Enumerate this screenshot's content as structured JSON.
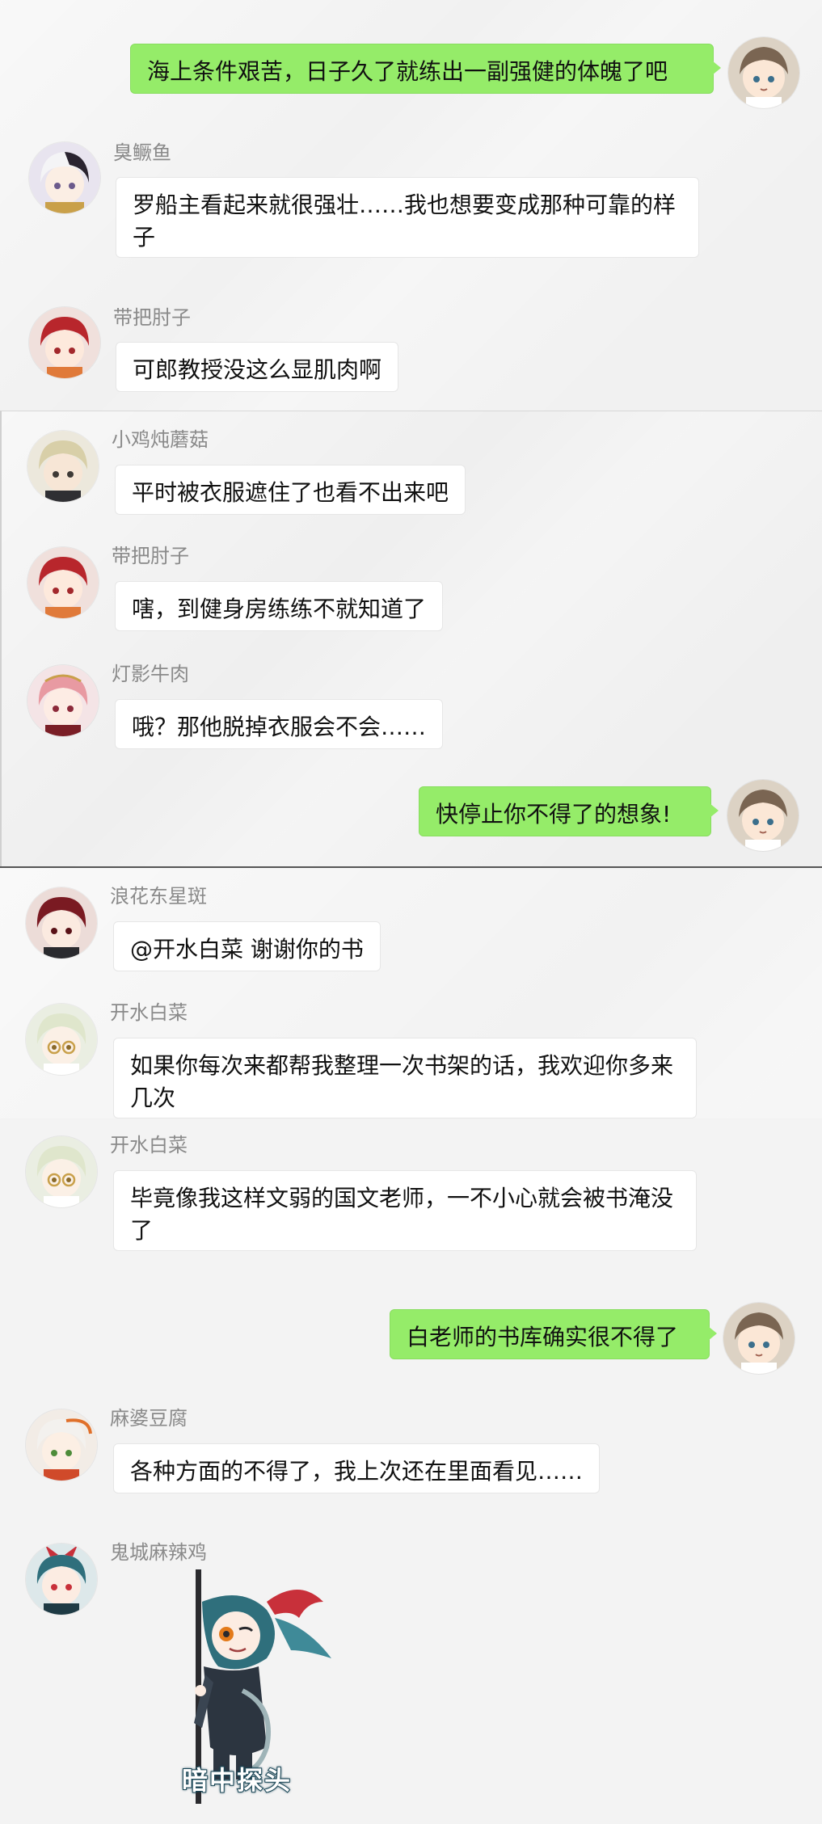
{
  "panels": [
    {
      "messages": [
        {
          "side": "right",
          "sender": "",
          "text": "海上条件艰苦，日子久了就练出一副强健的体魄了吧",
          "avatar": "brown-hair-boy-avatar"
        },
        {
          "side": "left",
          "sender": "臭鳜鱼",
          "text": "罗船主看起来就很强壮……我也想要变成那种可靠的样子",
          "avatar": "white-hair-boy-avatar"
        },
        {
          "side": "left",
          "sender": "带把肘子",
          "text": "可郎教授没这么显肌肉啊",
          "avatar": "red-hair-boy-avatar"
        }
      ]
    },
    {
      "messages": [
        {
          "side": "left",
          "sender": "小鸡炖蘑菇",
          "text": "平时被衣服遮住了也看不出来吧",
          "avatar": "blonde-hair-boy-avatar"
        },
        {
          "side": "left",
          "sender": "带把肘子",
          "text": "嗐，到健身房练练不就知道了",
          "avatar": "red-hair-boy-avatar"
        },
        {
          "side": "left",
          "sender": "灯影牛肉",
          "text": "哦？那他脱掉衣服会不会……",
          "avatar": "pink-hair-boy-avatar"
        },
        {
          "side": "right",
          "sender": "",
          "text": "快停止你不得了的想象!",
          "avatar": "brown-hair-boy-avatar"
        }
      ]
    },
    {
      "messages": [
        {
          "side": "left",
          "sender": "浪花东星斑",
          "text": "@开水白菜  谢谢你的书",
          "avatar": "dark-red-hair-boy-avatar"
        },
        {
          "side": "left",
          "sender": "开水白菜",
          "text": "如果你每次来都帮我整理一次书架的话，我欢迎你多来几次",
          "avatar": "glasses-pale-hair-avatar"
        },
        {
          "side": "left",
          "sender": "开水白菜",
          "text": "毕竟像我这样文弱的国文老师，一不小心就会被书淹没了",
          "avatar": "glasses-pale-hair-avatar"
        },
        {
          "side": "right",
          "sender": "",
          "text": "白老师的书库确实很不得了",
          "avatar": "brown-hair-boy-avatar"
        },
        {
          "side": "left",
          "sender": "麻婆豆腐",
          "text": "各种方面的不得了，我上次还在里面看见……",
          "avatar": "white-orange-hair-avatar"
        },
        {
          "side": "left",
          "sender": "鬼城麻辣鸡",
          "text": "",
          "avatar": "teal-hair-horned-avatar"
        }
      ],
      "sticker": {
        "caption": "暗中探头",
        "icon": "peeking-character-sticker"
      }
    }
  ],
  "colors": {
    "self_bubble": "#95ec69",
    "other_bubble": "#ffffff",
    "sender_name": "#8a8a8a",
    "background": "#f1f1f1"
  }
}
